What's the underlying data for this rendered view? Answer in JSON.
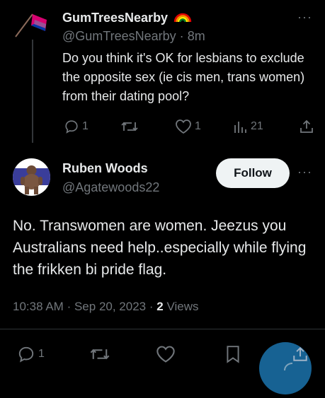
{
  "tweet1": {
    "display_name": "GumTreesNearby",
    "handle": "@GumTreesNearby",
    "separator": "·",
    "time": "8m",
    "body": "Do you think it's OK for lesbians to exclude the opposite sex (ie cis men, trans women) from their dating pool?",
    "replies": "1",
    "likes": "1",
    "views": "21",
    "more": "···"
  },
  "tweet2": {
    "display_name": "Ruben Woods",
    "handle": "@Agatewoods22",
    "follow_label": "Follow",
    "more": "···",
    "body": "No. Transwomen are women. Jeezus you Australians need help..especially while flying the frikken bi pride flag.",
    "time": "10:38 AM",
    "dot1": "·",
    "date": "Sep 20, 2023",
    "dot2": "·",
    "views_count": "2",
    "views_label": "Views",
    "replies": "1"
  },
  "colors": {
    "background": "#000000",
    "text": "#e7e9ea",
    "muted": "#71767b",
    "accent": "#1d9bf0",
    "bi_pink": "#d60270",
    "bi_purple": "#9b4f96",
    "bi_blue": "#0038a8"
  },
  "icons": [
    "bi-flag-icon",
    "rainbow-icon",
    "reply-icon",
    "retweet-icon",
    "like-icon",
    "views-icon",
    "share-icon",
    "bookmark-icon",
    "compose-icon"
  ]
}
